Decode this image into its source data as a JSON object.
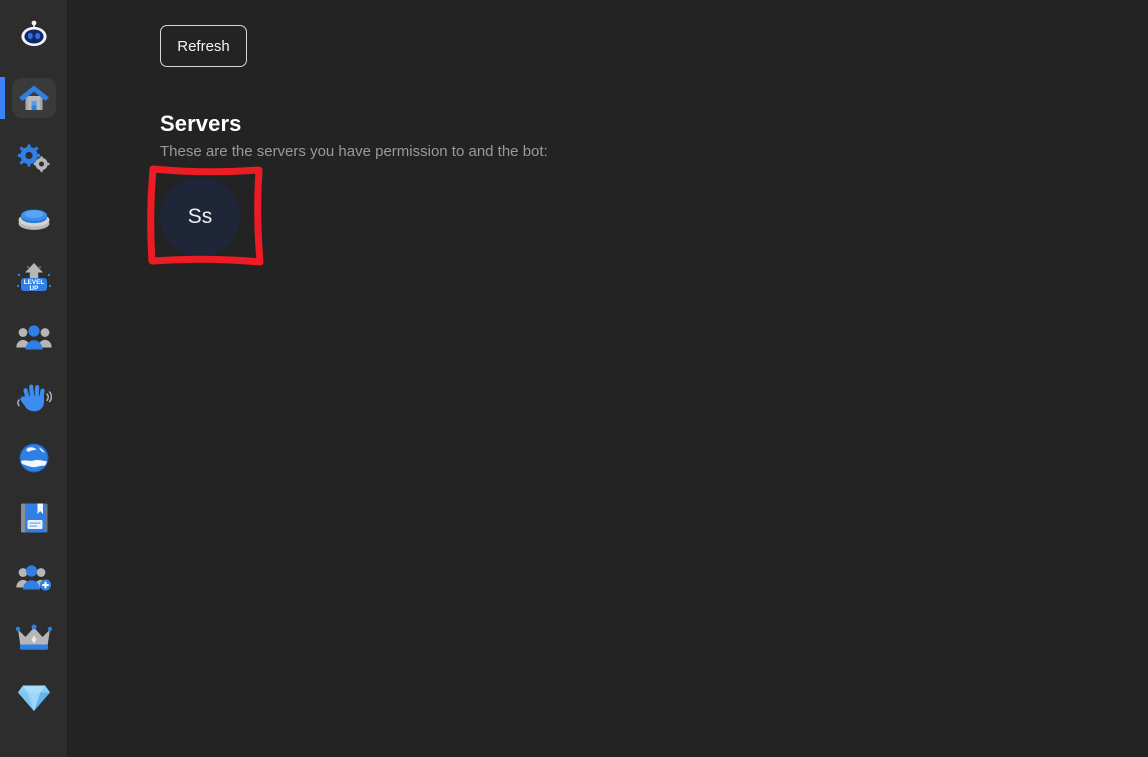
{
  "app": {
    "background_color": "#232323",
    "sidebar_color": "#2d2d2d",
    "accent_color": "#3b82f6",
    "annotation_color": "#ed1c24"
  },
  "sidebar": {
    "brand": {
      "icon": "bot-head-icon",
      "label": "Bot"
    },
    "items": [
      {
        "icon": "bot-head-icon",
        "label": "Bot",
        "active": false
      },
      {
        "icon": "home-icon",
        "label": "Home",
        "active": true
      },
      {
        "icon": "gears-icon",
        "label": "Settings",
        "active": false
      },
      {
        "icon": "button-icon",
        "label": "Buttons",
        "active": false
      },
      {
        "icon": "level-up-icon",
        "label": "Level Up",
        "active": false
      },
      {
        "icon": "users-icon",
        "label": "Members",
        "active": false
      },
      {
        "icon": "waving-hand-icon",
        "label": "Welcome",
        "active": false
      },
      {
        "icon": "globe-icon",
        "label": "Global",
        "active": false
      },
      {
        "icon": "book-icon",
        "label": "Logs",
        "active": false
      },
      {
        "icon": "add-user-icon",
        "label": "Invites",
        "active": false
      },
      {
        "icon": "crown-icon",
        "label": "Premium",
        "active": false
      },
      {
        "icon": "diamond-icon",
        "label": "Diamond",
        "active": false
      }
    ]
  },
  "main": {
    "refresh_button": {
      "label": "Refresh",
      "icon": "refresh-button"
    },
    "servers_section": {
      "title": "Servers",
      "subtitle": "These are the servers you have permission to and the bot:",
      "servers": [
        {
          "initials": "Ss",
          "avatar_color": "#1e2637",
          "highlighted": true
        }
      ]
    }
  },
  "annotation": {
    "type": "hand-drawn-rectangle",
    "color": "#ed1c24",
    "stroke_width": 7,
    "target": "server-avatar-ss"
  }
}
